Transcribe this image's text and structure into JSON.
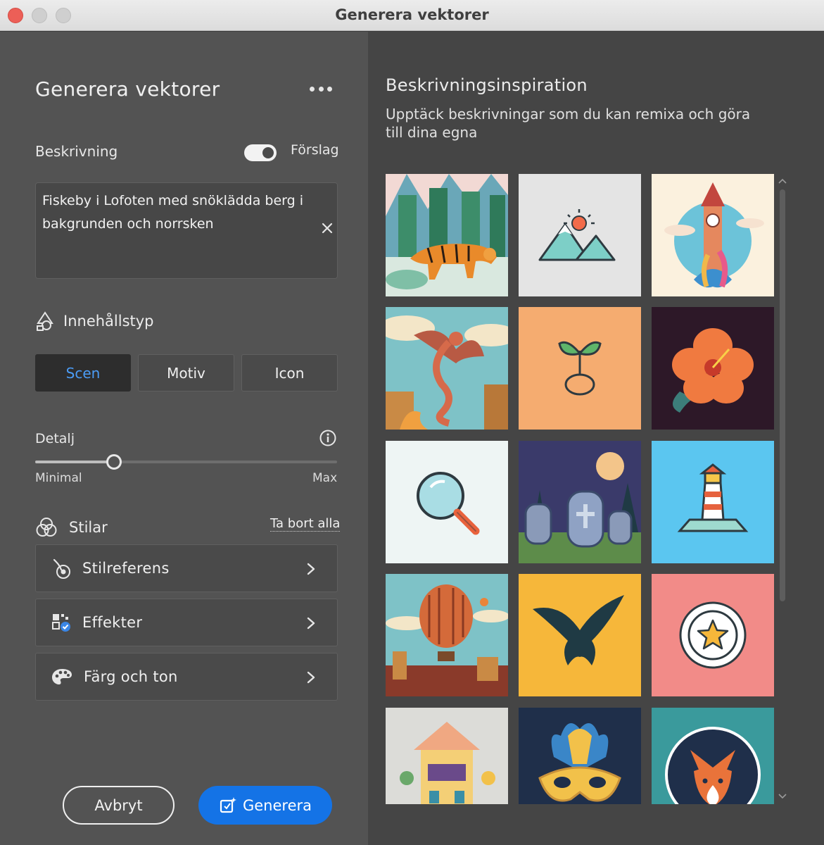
{
  "window": {
    "title": "Generera vektorer"
  },
  "panel": {
    "title": "Generera vektorer",
    "more_icon": "more-horizontal-icon"
  },
  "description": {
    "label": "Beskrivning",
    "suggestions_label": "Förslag",
    "suggestions_on": true,
    "value": "Fiskeby i Lofoten med snöklädda berg i bakgrunden och norrsken"
  },
  "content_type": {
    "label": "Innehållstyp",
    "options": [
      "Scen",
      "Motiv",
      "Icon"
    ],
    "selected": "Scen"
  },
  "detail": {
    "label": "Detalj",
    "min_label": "Minimal",
    "max_label": "Max",
    "value": 0.26
  },
  "styles": {
    "label": "Stilar",
    "remove_all": "Ta bort alla",
    "items": [
      {
        "label": "Stilreferens",
        "icon": "style-reference-icon"
      },
      {
        "label": "Effekter",
        "icon": "effects-icon"
      },
      {
        "label": "Färg och ton",
        "icon": "palette-icon"
      }
    ]
  },
  "footer": {
    "cancel": "Avbryt",
    "generate": "Generera"
  },
  "inspiration": {
    "title": "Beskrivningsinspiration",
    "subtitle": "Upptäck beskrivningar som du kan remixa och göra till dina egna",
    "thumbnails": [
      "tiger-forest-image",
      "mountain-sun-icon-image",
      "clock-tower-image",
      "dragon-image",
      "sprout-icon-image",
      "hibiscus-flower-image",
      "magnifier-icon-image",
      "graveyard-moon-image",
      "lighthouse-icon-image",
      "hot-air-balloon-image",
      "eagle-image",
      "star-badge-image",
      "carousel-house-image",
      "carnival-mask-image",
      "fox-image"
    ]
  },
  "colors": {
    "accent": "#1473e6",
    "selected_text": "#4b9cf5"
  }
}
